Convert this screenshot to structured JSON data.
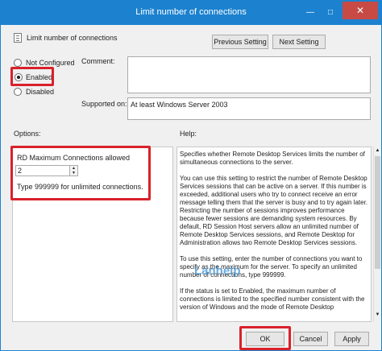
{
  "window": {
    "title": "Limit number of connections",
    "minimize_glyph": "—",
    "maximize_glyph": "□",
    "close_glyph": "✕"
  },
  "header": {
    "policy_name": "Limit number of connections",
    "prev_label": "Previous Setting",
    "next_label": "Next Setting"
  },
  "state": {
    "not_configured_label": "Not Configured",
    "enabled_label": "Enabled",
    "disabled_label": "Disabled",
    "selected": "Enabled"
  },
  "comment_label": "Comment:",
  "supported_on": {
    "label": "Supported on:",
    "value": "At least Windows Server 2003"
  },
  "options": {
    "label": "Options:",
    "max_connections_label": "RD Maximum Connections allowed",
    "max_connections_value": "2",
    "hint": "Type 999999 for unlimited connections."
  },
  "help": {
    "label": "Help:",
    "paragraphs": [
      "Specifies whether Remote Desktop Services limits the number of simultaneous connections to the server.",
      "You can use this setting to restrict the number of Remote Desktop Services sessions that can be active on a server. If this number is exceeded, additional users who try to connect receive an error message telling them that the server is busy and to try again later. Restricting the number of sessions improves performance because fewer sessions are demanding system resources. By default, RD Session Host servers allow an unlimited number of Remote Desktop Services sessions, and Remote Desktop for Administration allows two Remote Desktop Services sessions.",
      "To use this setting, enter the number of connections you want to specify as the maximum for the server. To specify an unlimited number of connections, type 999999.",
      "If the status is set to Enabled, the maximum number of connections is limited to the specified number consistent with the version of Windows and the mode of Remote Desktop"
    ]
  },
  "watermark": "Lanhelp",
  "footer": {
    "ok_label": "OK",
    "cancel_label": "Cancel",
    "apply_label": "Apply"
  },
  "colors": {
    "titlebar": "#1c82cf",
    "close_button": "#c74a45",
    "highlight": "#d9212b"
  }
}
